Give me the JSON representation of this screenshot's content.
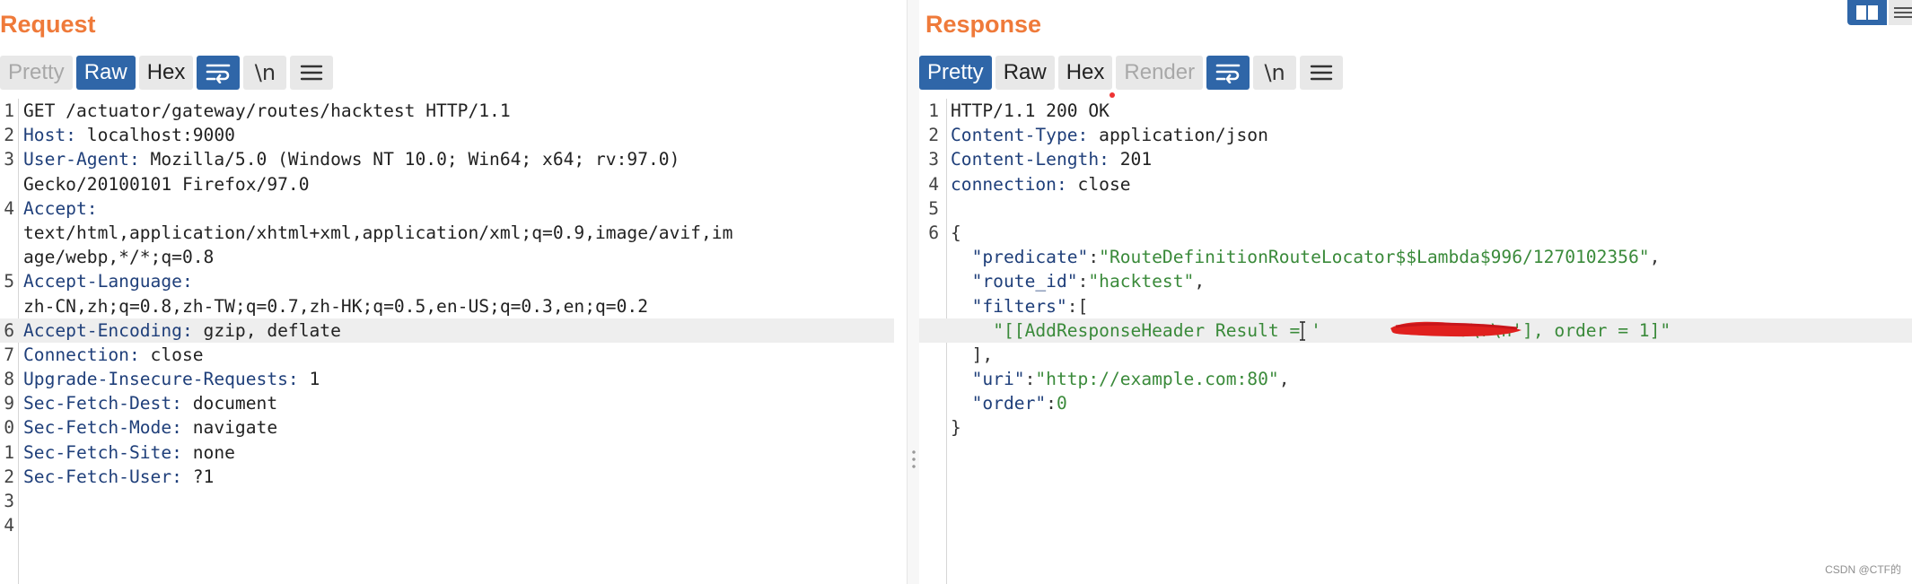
{
  "request": {
    "title": "Request",
    "tabs": [
      {
        "label": "Pretty",
        "state": "disabled"
      },
      {
        "label": "Raw",
        "state": "active"
      },
      {
        "label": "Hex",
        "state": "normal"
      }
    ],
    "newline_label": "\\n",
    "lines": [
      {
        "n": "1",
        "parts": [
          {
            "t": "GET /actuator/gateway/routes/hacktest HTTP/1.1",
            "c": "hv"
          }
        ]
      },
      {
        "n": "2",
        "parts": [
          {
            "t": "Host:",
            "c": "hk"
          },
          {
            "t": " localhost:9000",
            "c": "hv"
          }
        ]
      },
      {
        "n": "3",
        "parts": [
          {
            "t": "User-Agent:",
            "c": "hk"
          },
          {
            "t": " Mozilla/5.0 (Windows NT 10.0; Win64; x64; rv:97.0)",
            "c": "hv"
          }
        ]
      },
      {
        "n": "",
        "parts": [
          {
            "t": "Gecko/20100101 Firefox/97.0",
            "c": "hv"
          }
        ]
      },
      {
        "n": "4",
        "parts": [
          {
            "t": "Accept:",
            "c": "hk"
          }
        ]
      },
      {
        "n": "",
        "parts": [
          {
            "t": "text/html,application/xhtml+xml,application/xml;q=0.9,image/avif,im",
            "c": "hv"
          }
        ]
      },
      {
        "n": "",
        "parts": [
          {
            "t": "age/webp,*/*;q=0.8",
            "c": "hv"
          }
        ]
      },
      {
        "n": "5",
        "parts": [
          {
            "t": "Accept-Language:",
            "c": "hk"
          }
        ]
      },
      {
        "n": "",
        "parts": [
          {
            "t": "zh-CN,zh;q=0.8,zh-TW;q=0.7,zh-HK;q=0.5,en-US;q=0.3,en;q=0.2",
            "c": "hv"
          }
        ]
      },
      {
        "n": "6",
        "hl": true,
        "parts": [
          {
            "t": "Accept-Encoding:",
            "c": "hk"
          },
          {
            "t": " gzip, deflate",
            "c": "hv"
          }
        ]
      },
      {
        "n": "7",
        "parts": [
          {
            "t": "Connection:",
            "c": "hk"
          },
          {
            "t": " close",
            "c": "hv"
          }
        ]
      },
      {
        "n": "8",
        "parts": [
          {
            "t": "Upgrade-Insecure-Requests:",
            "c": "hk"
          },
          {
            "t": " 1",
            "c": "hv"
          }
        ]
      },
      {
        "n": "9",
        "parts": [
          {
            "t": "Sec-Fetch-Dest:",
            "c": "hk"
          },
          {
            "t": " document",
            "c": "hv"
          }
        ]
      },
      {
        "n": "0",
        "parts": [
          {
            "t": "Sec-Fetch-Mode:",
            "c": "hk"
          },
          {
            "t": " navigate",
            "c": "hv"
          }
        ]
      },
      {
        "n": "1",
        "parts": [
          {
            "t": "Sec-Fetch-Site:",
            "c": "hk"
          },
          {
            "t": " none",
            "c": "hv"
          }
        ]
      },
      {
        "n": "2",
        "parts": [
          {
            "t": "Sec-Fetch-User:",
            "c": "hk"
          },
          {
            "t": " ?1",
            "c": "hv"
          }
        ]
      },
      {
        "n": "3",
        "parts": []
      },
      {
        "n": "4",
        "parts": []
      }
    ]
  },
  "response": {
    "title": "Response",
    "tabs": [
      {
        "label": "Pretty",
        "state": "active"
      },
      {
        "label": "Raw",
        "state": "normal"
      },
      {
        "label": "Hex",
        "state": "normal"
      },
      {
        "label": "Render",
        "state": "disabled"
      }
    ],
    "newline_label": "\\n",
    "lines": [
      {
        "n": "1",
        "parts": [
          {
            "t": "HTTP/1.1 200 OK",
            "c": "hv"
          }
        ]
      },
      {
        "n": "2",
        "parts": [
          {
            "t": "Content-Type:",
            "c": "hk"
          },
          {
            "t": " application/json",
            "c": "hv"
          }
        ]
      },
      {
        "n": "3",
        "parts": [
          {
            "t": "Content-Length:",
            "c": "hk"
          },
          {
            "t": " 201",
            "c": "hv"
          }
        ]
      },
      {
        "n": "4",
        "parts": [
          {
            "t": "connection:",
            "c": "hk"
          },
          {
            "t": " close",
            "c": "hv"
          }
        ]
      },
      {
        "n": "5",
        "parts": []
      },
      {
        "n": "6",
        "parts": [
          {
            "t": "{",
            "c": "jp"
          }
        ]
      },
      {
        "n": "",
        "parts": [
          {
            "t": "  ",
            "c": "jp"
          },
          {
            "t": "\"predicate\"",
            "c": "jk"
          },
          {
            "t": ":",
            "c": "jp"
          },
          {
            "t": "\"RouteDefinitionRouteLocator$$Lambda$996/1270102356\"",
            "c": "js"
          },
          {
            "t": ",",
            "c": "jp"
          }
        ]
      },
      {
        "n": "",
        "parts": [
          {
            "t": "  ",
            "c": "jp"
          },
          {
            "t": "\"route_id\"",
            "c": "jk"
          },
          {
            "t": ":",
            "c": "jp"
          },
          {
            "t": "\"hacktest\"",
            "c": "js"
          },
          {
            "t": ",",
            "c": "jp"
          }
        ]
      },
      {
        "n": "",
        "parts": [
          {
            "t": "  ",
            "c": "jp"
          },
          {
            "t": "\"filters\"",
            "c": "jk"
          },
          {
            "t": ":[",
            "c": "jp"
          }
        ]
      },
      {
        "n": "",
        "hl": true,
        "parts": [
          {
            "t": "    ",
            "c": "jp"
          },
          {
            "t": "\"[[AddResponseHeader Result = '",
            "c": "js"
          },
          {
            "t": "             ",
            "c": "js"
          },
          {
            "t": "a\\r\\n'], order = 1]\"",
            "c": "js"
          }
        ]
      },
      {
        "n": "",
        "parts": [
          {
            "t": "  ],",
            "c": "jp"
          }
        ]
      },
      {
        "n": "",
        "parts": [
          {
            "t": "  ",
            "c": "jp"
          },
          {
            "t": "\"uri\"",
            "c": "jk"
          },
          {
            "t": ":",
            "c": "jp"
          },
          {
            "t": "\"http://example.com:80\"",
            "c": "js"
          },
          {
            "t": ",",
            "c": "jp"
          }
        ]
      },
      {
        "n": "",
        "parts": [
          {
            "t": "  ",
            "c": "jp"
          },
          {
            "t": "\"order\"",
            "c": "jk"
          },
          {
            "t": ":",
            "c": "jp"
          },
          {
            "t": "0",
            "c": "jn"
          }
        ]
      },
      {
        "n": "",
        "parts": [
          {
            "t": "}",
            "c": "jp"
          }
        ]
      }
    ]
  },
  "watermark": "CSDN @CTF的",
  "colors": {
    "accent": "#2f66a8",
    "title": "#ef7a3a",
    "key": "#1f3f7a",
    "string": "#3a8a3a"
  }
}
